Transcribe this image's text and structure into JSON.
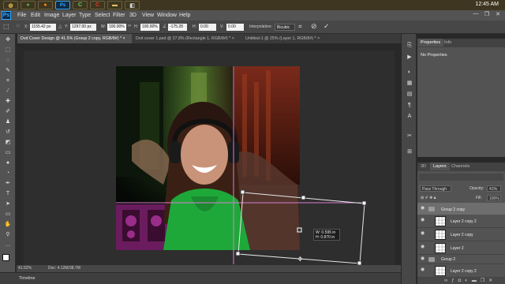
{
  "taskbar": {
    "apps": [
      {
        "icon": "file-explorer-icon",
        "glyph": "◍",
        "color": "#d9b24a"
      },
      {
        "icon": "chrome-icon",
        "glyph": "●",
        "color": "#4caf50"
      },
      {
        "icon": "firefox-icon",
        "glyph": "●",
        "color": "#ff8a00"
      },
      {
        "icon": "photoshop-icon",
        "glyph": "Ps",
        "color": "#31a8ff"
      },
      {
        "icon": "camtasia-icon",
        "glyph": "C",
        "color": "#5fd35f"
      },
      {
        "icon": "corel-icon",
        "glyph": "C",
        "color": "#e23b2e"
      },
      {
        "icon": "folder-icon",
        "glyph": "▬",
        "color": "#e0c060"
      },
      {
        "icon": "network-icon",
        "glyph": "◧",
        "color": "#cfcfcf"
      }
    ],
    "clock": "12:45 AM"
  },
  "menubar": {
    "logo": "Ps",
    "items": [
      "File",
      "Edit",
      "Image",
      "Layer",
      "Type",
      "Select",
      "Filter",
      "3D",
      "View",
      "Window",
      "Help"
    ]
  },
  "options": {
    "x_label": "X:",
    "x_value": "1155.42 px",
    "y_label": "Y:",
    "y_value": "1297.00 px",
    "w_label": "W:",
    "w_value": "100.00%",
    "h_label": "H:",
    "h_value": "100.00%",
    "angle_value": "-175.28",
    "h_skew_label": "H:",
    "h_skew_value": "0.00",
    "v_skew_label": "V:",
    "v_skew_value": "0.00",
    "interpolation_label": "Interpolation:",
    "interpolation_value": "Bicubic"
  },
  "tabs": [
    {
      "label": "Dvd Cover Design @ 41.5% (Group 2 copy, RGB/8#) *",
      "close": "×",
      "active": true
    },
    {
      "label": "Dvd cover 1.psd @ 27.8% (Rectangle 1, RGB/8#) *",
      "close": "×",
      "active": false
    },
    {
      "label": "Untitled-1 @ 25% (Layer 1, RGB/8#) *",
      "close": "×",
      "active": false
    }
  ],
  "transform_hud": {
    "width": "W: 0.595 in",
    "height": "H: 0.870 in"
  },
  "status": {
    "zoom": "41.52%",
    "doc": "Doc: 4.12M/38.7M"
  },
  "timeline": {
    "label": "Timeline"
  },
  "properties_panel": {
    "tabs": [
      "Properties",
      "Info"
    ],
    "message": "No Properties"
  },
  "layers_panel": {
    "tabs": [
      "3D",
      "Layers",
      "Channels"
    ],
    "blend_mode": "Pass Through",
    "opacity_label": "Opacity:",
    "opacity_value": "41%",
    "fill_label": "Fill:",
    "fill_value": "100%",
    "layers": [
      {
        "name": "Group 2 copy",
        "type": "group",
        "selected": true
      },
      {
        "name": "Layer 2 copy 2",
        "type": "layer",
        "selected": false
      },
      {
        "name": "Layer 2 copy",
        "type": "layer",
        "selected": false
      },
      {
        "name": "Layer 2",
        "type": "layer",
        "selected": false
      },
      {
        "name": "Group 2",
        "type": "group",
        "selected": false
      },
      {
        "name": "Layer 2 copy 2",
        "type": "layer",
        "selected": false
      }
    ]
  }
}
